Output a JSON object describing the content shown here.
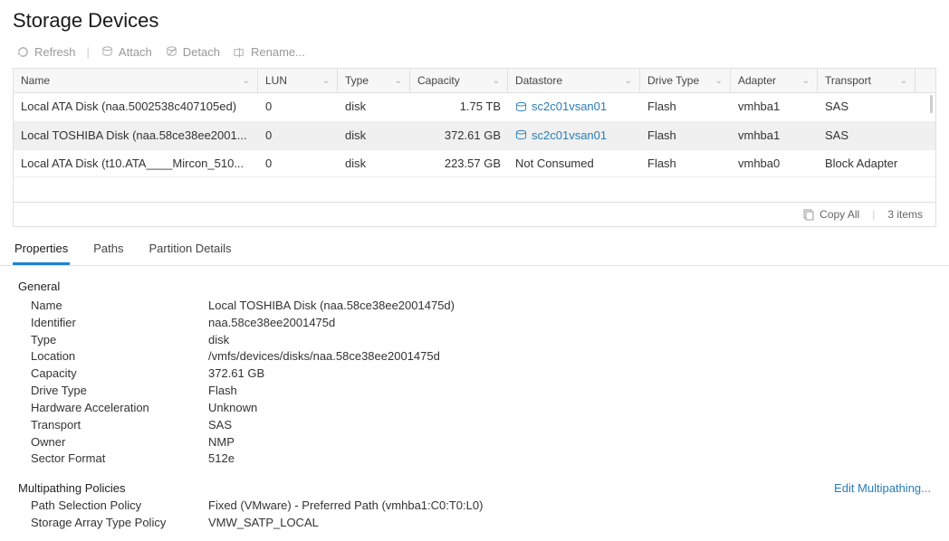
{
  "page": {
    "title": "Storage Devices"
  },
  "toolbar": {
    "refresh": "Refresh",
    "attach": "Attach",
    "detach": "Detach",
    "rename": "Rename..."
  },
  "table": {
    "headers": {
      "name": "Name",
      "lun": "LUN",
      "type": "Type",
      "capacity": "Capacity",
      "datastore": "Datastore",
      "drive_type": "Drive Type",
      "adapter": "Adapter",
      "transport": "Transport"
    },
    "rows": [
      {
        "name": "Local ATA Disk (naa.5002538c407105ed)",
        "lun": "0",
        "type": "disk",
        "capacity": "1.75 TB",
        "datastore": "sc2c01vsan01",
        "datastore_linked": true,
        "drive_type": "Flash",
        "adapter": "vmhba1",
        "transport": "SAS",
        "selected": false
      },
      {
        "name": "Local TOSHIBA Disk (naa.58ce38ee2001...",
        "lun": "0",
        "type": "disk",
        "capacity": "372.61 GB",
        "datastore": "sc2c01vsan01",
        "datastore_linked": true,
        "drive_type": "Flash",
        "adapter": "vmhba1",
        "transport": "SAS",
        "selected": true
      },
      {
        "name": "Local ATA Disk (t10.ATA____Mircon_510...",
        "lun": "0",
        "type": "disk",
        "capacity": "223.57 GB",
        "datastore": "Not Consumed",
        "datastore_linked": false,
        "drive_type": "Flash",
        "adapter": "vmhba0",
        "transport": "Block Adapter",
        "selected": false
      }
    ],
    "footer": {
      "copy_all": "Copy All",
      "item_count": "3 items"
    }
  },
  "tabs": {
    "properties": "Properties",
    "paths": "Paths",
    "partition_details": "Partition Details"
  },
  "details": {
    "general": {
      "title": "General",
      "fields": {
        "name": {
          "label": "Name",
          "value": "Local TOSHIBA Disk (naa.58ce38ee2001475d)"
        },
        "identifier": {
          "label": "Identifier",
          "value": "naa.58ce38ee2001475d"
        },
        "type": {
          "label": "Type",
          "value": "disk"
        },
        "location": {
          "label": "Location",
          "value": "/vmfs/devices/disks/naa.58ce38ee2001475d"
        },
        "capacity": {
          "label": "Capacity",
          "value": "372.61 GB"
        },
        "drive_type": {
          "label": "Drive Type",
          "value": "Flash"
        },
        "hw_accel": {
          "label": "Hardware Acceleration",
          "value": "Unknown"
        },
        "transport": {
          "label": "Transport",
          "value": "SAS"
        },
        "owner": {
          "label": "Owner",
          "value": "NMP"
        },
        "sector_format": {
          "label": "Sector Format",
          "value": "512e"
        }
      }
    },
    "multipathing": {
      "title": "Multipathing Policies",
      "edit_link": "Edit Multipathing...",
      "fields": {
        "psp": {
          "label": "Path Selection Policy",
          "value": "Fixed (VMware) - Preferred Path (vmhba1:C0:T0:L0)"
        },
        "satp": {
          "label": "Storage Array Type Policy",
          "value": "VMW_SATP_LOCAL"
        }
      }
    }
  }
}
